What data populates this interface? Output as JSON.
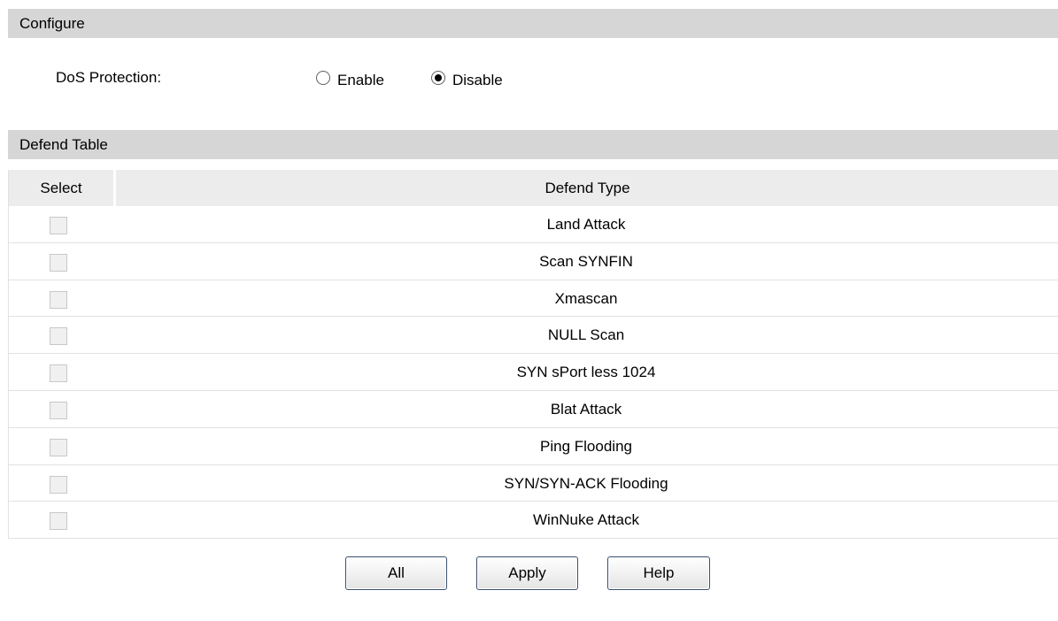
{
  "configure": {
    "header": "Configure",
    "dos_label": "DoS Protection:",
    "options": [
      {
        "label": "Enable",
        "checked": false
      },
      {
        "label": "Disable",
        "checked": true
      }
    ]
  },
  "defend_table": {
    "header": "Defend Table",
    "columns": [
      "Select",
      "Defend Type"
    ],
    "rows": [
      {
        "selected": false,
        "type": "Land Attack"
      },
      {
        "selected": false,
        "type": "Scan SYNFIN"
      },
      {
        "selected": false,
        "type": "Xmascan"
      },
      {
        "selected": false,
        "type": "NULL Scan"
      },
      {
        "selected": false,
        "type": "SYN sPort less 1024"
      },
      {
        "selected": false,
        "type": "Blat Attack"
      },
      {
        "selected": false,
        "type": "Ping Flooding"
      },
      {
        "selected": false,
        "type": "SYN/SYN-ACK Flooding"
      },
      {
        "selected": false,
        "type": "WinNuke Attack"
      }
    ]
  },
  "buttons": {
    "all": "All",
    "apply": "Apply",
    "help": "Help"
  }
}
